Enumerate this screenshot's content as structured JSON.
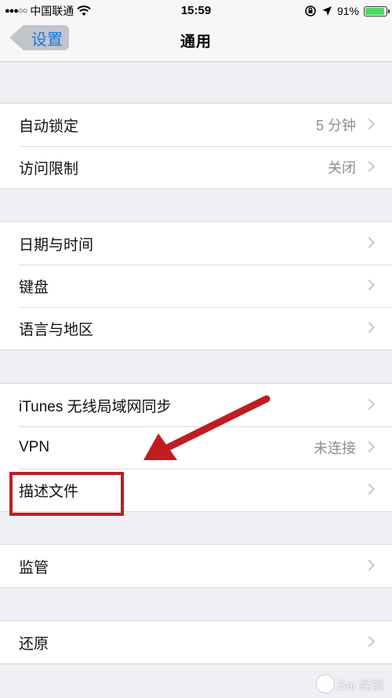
{
  "status_bar": {
    "signal_dots": "●●●○○",
    "carrier": "中国联通",
    "time": "15:59",
    "battery_percent": "91%",
    "battery_level": 0.91,
    "battery_color": "#4cd964"
  },
  "nav": {
    "back_label": "设置",
    "title": "通用"
  },
  "groups": [
    {
      "rows": [
        {
          "label": "自动锁定",
          "value": "5 分钟"
        },
        {
          "label": "访问限制",
          "value": "关闭"
        }
      ]
    },
    {
      "rows": [
        {
          "label": "日期与时间",
          "value": ""
        },
        {
          "label": "键盘",
          "value": ""
        },
        {
          "label": "语言与地区",
          "value": ""
        }
      ]
    },
    {
      "rows": [
        {
          "label": "iTunes 无线局域网同步",
          "value": ""
        },
        {
          "label": "VPN",
          "value": "未连接"
        },
        {
          "label": "描述文件",
          "value": ""
        }
      ]
    },
    {
      "rows": [
        {
          "label": "监管",
          "value": ""
        }
      ]
    },
    {
      "rows": [
        {
          "label": "还原",
          "value": ""
        }
      ]
    }
  ],
  "annotation": {
    "color": "#c01c22"
  },
  "watermark": {
    "text": "Bai 经验"
  }
}
